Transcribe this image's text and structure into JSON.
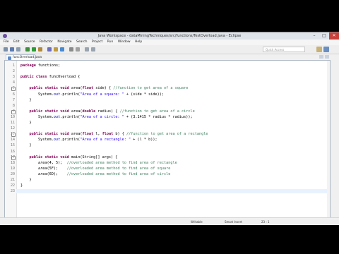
{
  "window": {
    "title": "Java Workspace - dataMiningTechniques/src/functions/TestOverload.java - Eclipse"
  },
  "menu": [
    "File",
    "Edit",
    "Source",
    "Refactor",
    "Navigate",
    "Search",
    "Project",
    "Run",
    "Window",
    "Help"
  ],
  "toolbar": {
    "quick_access": "Quick Access"
  },
  "editor": {
    "tab_label": "funcOverload.java",
    "lines": [
      {
        "n": "1",
        "html": "<span class='kw'>package</span> functions;"
      },
      {
        "n": "2",
        "html": ""
      },
      {
        "n": "3",
        "html": "<span class='kw'>public class</span> funcOverload {"
      },
      {
        "n": "4",
        "html": ""
      },
      {
        "n": "5",
        "html": "    <span class='kw'>public static void</span> area(<span class='kw'>float</span> side) { <span class='cm'>//function to get area of a square</span>"
      },
      {
        "n": "6",
        "html": "        System.<span class='it' style='color:#0000c0'>out</span>.println(<span class='str'>\"Area of a square: \"</span> + (side * side));"
      },
      {
        "n": "7",
        "html": "    }"
      },
      {
        "n": "8",
        "html": ""
      },
      {
        "n": "9",
        "html": "    <span class='kw'>public static void</span> area(<span class='kw'>double</span> radius) { <span class='cm'>//function to get area of a circle</span>"
      },
      {
        "n": "10",
        "html": "        System.<span class='it' style='color:#0000c0'>out</span>.println(<span class='str'>\"Area of a circle: \"</span> + (3.1415 * radius * radius));"
      },
      {
        "n": "11",
        "html": "    }"
      },
      {
        "n": "12",
        "html": ""
      },
      {
        "n": "13",
        "html": "    <span class='kw'>public static void</span> area(<span class='kw'>float</span> l, <span class='kw'>float</span> b) { <span class='cm'>//function to get area of a rectangle</span>"
      },
      {
        "n": "14",
        "html": "        System.<span class='it' style='color:#0000c0'>out</span>.println(<span class='str'>\"Area of a rectangle: \"</span> + (l * b));"
      },
      {
        "n": "15",
        "html": "    }"
      },
      {
        "n": "16",
        "html": ""
      },
      {
        "n": "17",
        "html": "    <span class='kw'>public static void</span> main(String[] args) {"
      },
      {
        "n": "18",
        "html": "        <span class='it'>area</span>(4, 5);  <span class='cm'>//overloaded area method to find area of rectangle</span>"
      },
      {
        "n": "19",
        "html": "        <span class='it'>area</span>(5F);    <span class='cm'>//overloaded area method to find area of square</span>"
      },
      {
        "n": "20",
        "html": "        <span class='it'>area</span>(6D);    <span class='cm'>//overloaded area method to find area of circle</span>"
      },
      {
        "n": "21",
        "html": "    }"
      },
      {
        "n": "22",
        "html": "}"
      },
      {
        "n": "23",
        "html": ""
      }
    ]
  },
  "status": {
    "writable": "Writable",
    "insert_mode": "Smart Insert",
    "position": "23 : 1"
  }
}
